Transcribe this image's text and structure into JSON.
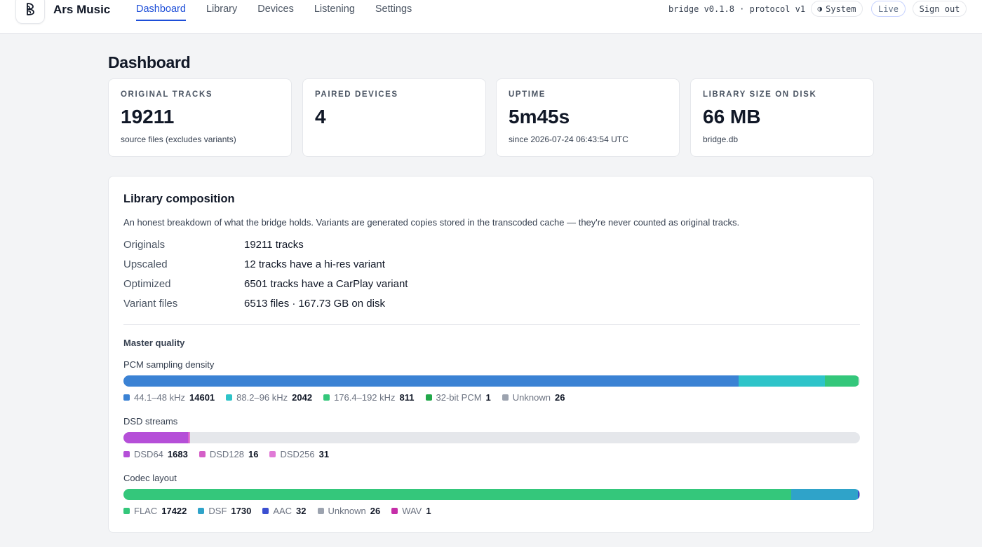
{
  "app": {
    "name": "Ars Music"
  },
  "nav": {
    "items": [
      "Dashboard",
      "Library",
      "Devices",
      "Listening",
      "Settings"
    ],
    "active": "Dashboard"
  },
  "header": {
    "version": "bridge v0.1.8 · protocol v1",
    "theme": "System",
    "theme_icon": "half-circle-icon",
    "status": "Live",
    "signout": "Sign out"
  },
  "page": {
    "title": "Dashboard"
  },
  "stats": [
    {
      "label": "ORIGINAL TRACKS",
      "value": "19211",
      "sub": "source files (excludes variants)"
    },
    {
      "label": "PAIRED DEVICES",
      "value": "4",
      "sub": ""
    },
    {
      "label": "UPTIME",
      "value": "5m45s",
      "sub": "since 2026-07-24 06:43:54 UTC"
    },
    {
      "label": "LIBRARY SIZE ON DISK",
      "value": "66 MB",
      "sub": "bridge.db"
    }
  ],
  "composition": {
    "title": "Library composition",
    "description": "An honest breakdown of what the bridge holds. Variants are generated copies stored in the transcoded cache — they're never counted as original tracks.",
    "rows": [
      {
        "label": "Originals",
        "value": "19211 tracks"
      },
      {
        "label": "Upscaled",
        "value": "12 tracks have a hi-res variant"
      },
      {
        "label": "Optimized",
        "value": "6501 tracks have a CarPlay variant"
      },
      {
        "label": "Variant files",
        "value": "6513 files · 167.73 GB on disk"
      }
    ],
    "quality_title": "Master quality",
    "bars": [
      {
        "label": "PCM sampling density",
        "total": 17481,
        "segments": [
          {
            "name": "44.1–48 kHz",
            "value": 14601,
            "color": "#3b82d4"
          },
          {
            "name": "88.2–96 kHz",
            "value": 2042,
            "color": "#2ec4c9"
          },
          {
            "name": "176.4–192 kHz",
            "value": 811,
            "color": "#34c77b"
          },
          {
            "name": "32-bit PCM",
            "value": 1,
            "color": "#22a84a"
          },
          {
            "name": "Unknown",
            "value": 26,
            "color": "#9ca3af"
          }
        ],
        "visible_segments": 4
      },
      {
        "label": "DSD streams",
        "total": 19211,
        "segments": [
          {
            "name": "DSD64",
            "value": 1683,
            "color": "#b54fd8"
          },
          {
            "name": "DSD128",
            "value": 16,
            "color": "#d45fc7"
          },
          {
            "name": "DSD256",
            "value": 31,
            "color": "#e07ad6"
          }
        ],
        "visible_segments": 3
      },
      {
        "label": "Codec layout",
        "total": 19211,
        "segments": [
          {
            "name": "FLAC",
            "value": 17422,
            "color": "#34c77b"
          },
          {
            "name": "DSF",
            "value": 1730,
            "color": "#2fa3c9"
          },
          {
            "name": "AAC",
            "value": 32,
            "color": "#3b4fd1"
          },
          {
            "name": "Unknown",
            "value": 26,
            "color": "#9ca3af"
          },
          {
            "name": "WAV",
            "value": 1,
            "color": "#c52ea8"
          }
        ],
        "visible_segments": 5
      }
    ]
  }
}
